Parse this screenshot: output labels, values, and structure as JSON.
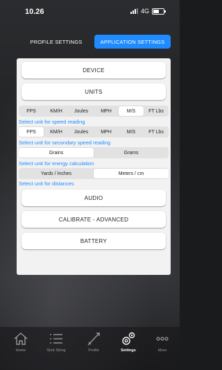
{
  "status_bar": {
    "time": "10.26",
    "network": "4G"
  },
  "top_tabs": [
    {
      "label": "PROFILE SETTINGS",
      "active": false
    },
    {
      "label": "APPLICATION SETTINGS",
      "active": true
    }
  ],
  "menu": {
    "device": "DEVICE",
    "units": "UNITS",
    "audio": "AUDIO",
    "calibrate": "CALIBRATE - ADVANCED",
    "battery": "BATTERY"
  },
  "units": {
    "speed": {
      "options": [
        "FPS",
        "KM/H",
        "Joules",
        "MPH",
        "M/S",
        "FT Lbs"
      ],
      "selected": "M/S",
      "caption": "Select unit for speed reading"
    },
    "secondary_speed": {
      "options": [
        "FPS",
        "KM/H",
        "Joules",
        "MPH",
        "M/S",
        "FT Lbs"
      ],
      "selected": "FPS",
      "caption": "Select unit for secondary speed reading"
    },
    "energy": {
      "options": [
        "Grains",
        "Grams"
      ],
      "selected": "Grains",
      "caption": "Select unit for energy calculation"
    },
    "distance": {
      "options": [
        "Yards / Inches",
        "Meters / cm"
      ],
      "selected": "Meters / cm",
      "caption": "Select unit for distances"
    }
  },
  "tab_bar": [
    {
      "label": "Home",
      "icon": "home-icon",
      "active": false
    },
    {
      "label": "Shot String",
      "icon": "list-icon",
      "active": false
    },
    {
      "label": "Profile",
      "icon": "arrow-icon",
      "active": false
    },
    {
      "label": "Settings",
      "icon": "gears-icon",
      "active": true
    },
    {
      "label": "More",
      "icon": "more-icon",
      "active": false
    }
  ],
  "colors": {
    "accent": "#1f8bff",
    "panel": "#f2f2f2"
  }
}
